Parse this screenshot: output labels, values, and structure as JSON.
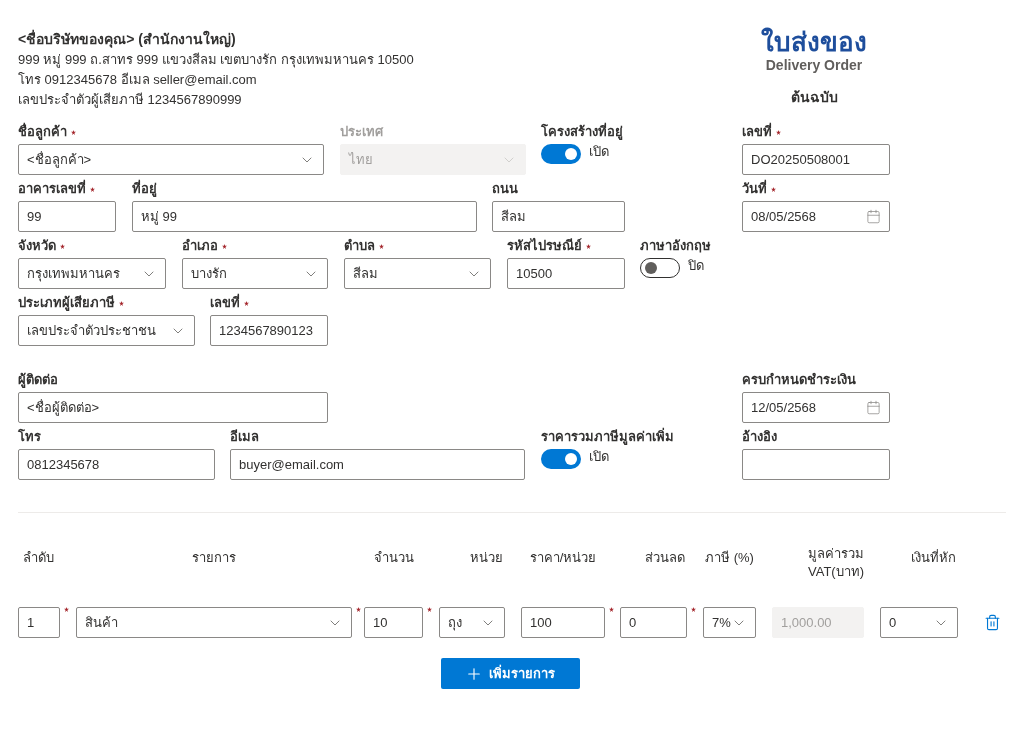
{
  "company": {
    "name": "<ชื่อบริษัทของคุณ> (สำนักงานใหญ่)",
    "lines": [
      "999 หมู่ 999 ถ.สาทร 999 แขวงสีลม เขตบางรัก กรุงเทพมหานคร 10500",
      "โทร 0912345678 อีเมล seller@email.com",
      "เลขประจำตัวผู้เสียภาษี 1234567890999"
    ]
  },
  "document": {
    "title": "ใบส่งของ",
    "subtitle": "Delivery Order",
    "copy": "ต้นฉบับ"
  },
  "form_rows": [
    [
      {
        "kind": "select",
        "label": "ชื่อลูกค้า",
        "required": true,
        "value": "<ชื่อลูกค้า>",
        "disabled": false
      },
      {
        "kind": "select",
        "label": "ประเทศ",
        "required": false,
        "value": "ไทย",
        "disabled": true
      },
      {
        "kind": "toggle",
        "label": "โครงสร้างที่อยู่",
        "on": true,
        "state_label": "เปิด"
      },
      {
        "kind": "input",
        "label": "เลขที่",
        "required": true,
        "value": "DO20250508001",
        "disabled": false
      }
    ],
    [
      {
        "kind": "input",
        "label": "อาคารเลขที่",
        "required": true,
        "value": "99",
        "disabled": false
      },
      {
        "kind": "input",
        "label": "ที่อยู่",
        "required": false,
        "value": "หมู่ 99",
        "disabled": false
      },
      {
        "kind": "input",
        "label": "ถนน",
        "required": false,
        "value": "สีลม",
        "disabled": false
      },
      {
        "kind": "date",
        "label": "วันที่",
        "required": true,
        "value": "08/05/2568",
        "disabled": false
      }
    ],
    [
      {
        "kind": "select",
        "label": "จังหวัด",
        "required": true,
        "value": "กรุงเทพมหานคร",
        "disabled": false
      },
      {
        "kind": "select",
        "label": "อำเภอ",
        "required": true,
        "value": "บางรัก",
        "disabled": false
      },
      {
        "kind": "select",
        "label": "ตำบล",
        "required": true,
        "value": "สีลม",
        "disabled": false
      },
      {
        "kind": "input",
        "label": "รหัสไปรษณีย์",
        "required": true,
        "value": "10500",
        "disabled": false
      },
      {
        "kind": "toggle",
        "label": "ภาษาอังกฤษ",
        "on": false,
        "state_label": "ปิด"
      }
    ],
    [
      {
        "kind": "select",
        "label": "ประเภทผู้เสียภาษี",
        "required": true,
        "value": "เลขประจำตัวประชาชน",
        "disabled": false
      },
      {
        "kind": "input",
        "label": "เลขที่",
        "required": true,
        "value": "1234567890123",
        "disabled": false
      }
    ],
    [
      {
        "kind": "input",
        "label": "ผู้ติดต่อ",
        "required": false,
        "value": "<ชื่อผู้ติดต่อ>",
        "disabled": false
      },
      {
        "kind": "date",
        "label": "ครบกำหนดชำระเงิน",
        "required": false,
        "value": "12/05/2568",
        "disabled": false
      }
    ],
    [
      {
        "kind": "input",
        "label": "โทร",
        "required": false,
        "value": "0812345678",
        "disabled": false
      },
      {
        "kind": "input",
        "label": "อีเมล",
        "required": false,
        "value": "buyer@email.com",
        "disabled": false
      },
      {
        "kind": "toggle",
        "label": "ราคารวมภาษีมูลค่าเพิ่ม",
        "on": true,
        "state_label": "เปิด"
      },
      {
        "kind": "input",
        "label": "อ้างอิง",
        "required": false,
        "disabled": false
      }
    ]
  ],
  "items_table": {
    "columns": [
      "ลำดับ",
      "รายการ",
      "จำนวน",
      "หน่วย",
      "ราคา/หน่วย",
      "ส่วนลด",
      "ภาษี (%)",
      "มูลค่ารวม VAT(บาท)",
      "เงินที่หัก"
    ],
    "rows": [
      {
        "cells": [
          {
            "kind": "input",
            "value": "1",
            "required": true,
            "disabled": false
          },
          {
            "kind": "select",
            "value": "สินค้า",
            "required": true,
            "disabled": false
          },
          {
            "kind": "input",
            "value": "10",
            "required": true,
            "disabled": false
          },
          {
            "kind": "select",
            "value": "ถุง",
            "required": false,
            "disabled": false
          },
          {
            "kind": "input",
            "value": "100",
            "required": true,
            "disabled": false
          },
          {
            "kind": "input",
            "value": "0",
            "required": true,
            "disabled": false
          },
          {
            "kind": "select",
            "value": "7%",
            "required": false,
            "disabled": false
          },
          {
            "kind": "input",
            "value": "1,000.00",
            "required": false,
            "disabled": true
          },
          {
            "kind": "select",
            "value": "0",
            "required": false,
            "disabled": false
          }
        ]
      }
    ]
  },
  "add_button": {
    "label": "เพิ่มรายการ"
  }
}
